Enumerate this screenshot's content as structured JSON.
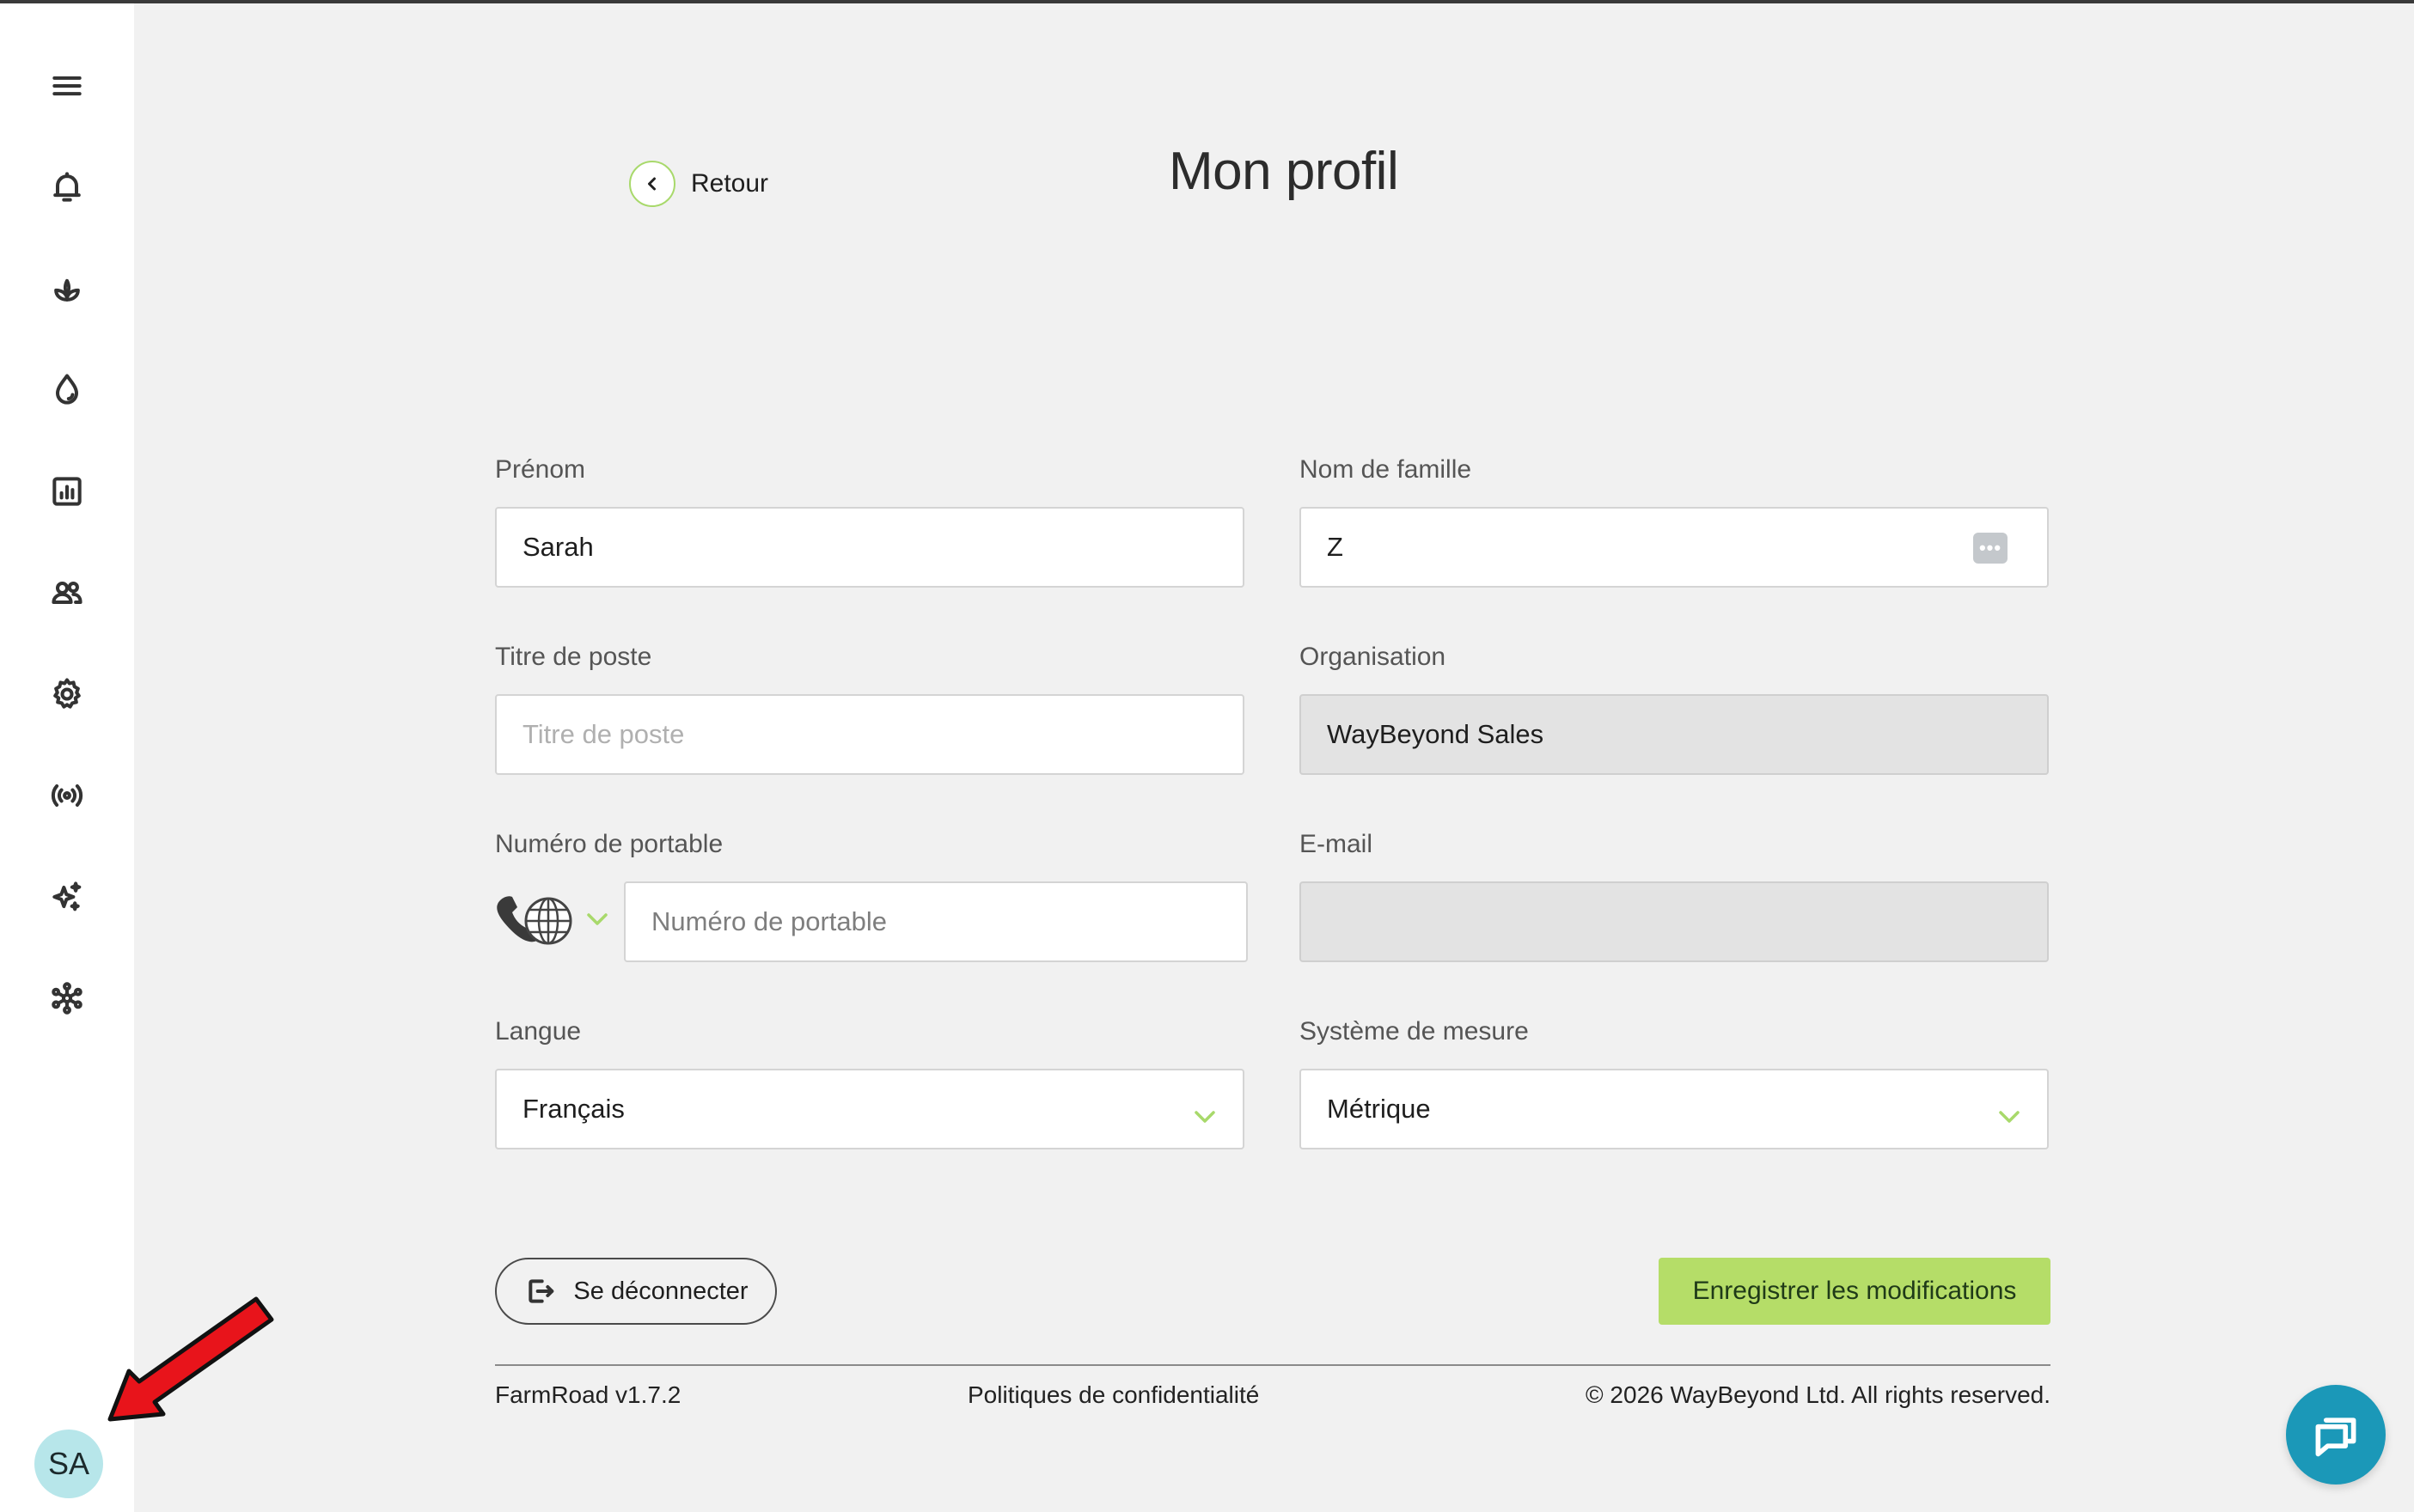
{
  "header": {
    "back_label": "Retour",
    "title": "Mon profil"
  },
  "sidebar": {
    "items": [
      {
        "icon": "menu-icon"
      },
      {
        "icon": "bell-icon"
      },
      {
        "icon": "plant-icon"
      },
      {
        "icon": "water-drop-icon"
      },
      {
        "icon": "report-chart-icon"
      },
      {
        "icon": "users-icon"
      },
      {
        "icon": "gear-icon"
      },
      {
        "icon": "broadcast-icon"
      },
      {
        "icon": "sparkles-icon"
      },
      {
        "icon": "network-icon"
      }
    ],
    "avatar_initials": "SA"
  },
  "form": {
    "first_name": {
      "label": "Prénom",
      "value": "Sarah"
    },
    "last_name": {
      "label": "Nom de famille",
      "value": "Z",
      "badge": "•••"
    },
    "job_title": {
      "label": "Titre de poste",
      "placeholder": "Titre de poste",
      "value": ""
    },
    "organisation": {
      "label": "Organisation",
      "value": "WayBeyond Sales"
    },
    "mobile": {
      "label": "Numéro de portable",
      "placeholder": "Numéro de portable",
      "value": ""
    },
    "email": {
      "label": "E-mail",
      "value": ""
    },
    "language": {
      "label": "Langue",
      "value": "Français"
    },
    "measure_system": {
      "label": "Système de mesure",
      "value": "Métrique"
    }
  },
  "actions": {
    "logout_label": "Se déconnecter",
    "save_label": "Enregistrer les modifications"
  },
  "footer": {
    "version": "FarmRoad v1.7.2",
    "privacy": "Politiques de confidentialité",
    "copyright": "© 2026 WayBeyond Ltd. All rights reserved."
  },
  "colors": {
    "accent": "#b5dd68",
    "chat": "#1b98b8",
    "avatar_bg": "#b7e6ea"
  }
}
